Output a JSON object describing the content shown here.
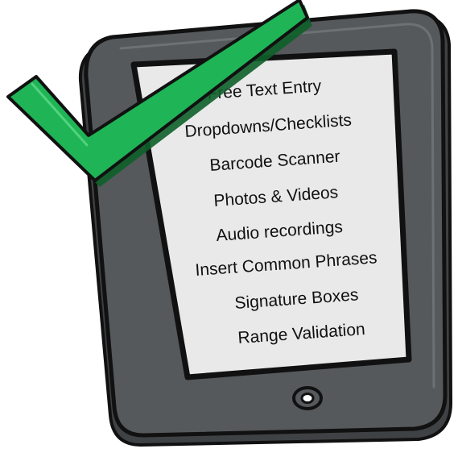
{
  "tablet": {
    "features": [
      "Free Text Entry",
      "Dropdowns/Checklists",
      "Barcode Scanner",
      "Photos & Videos",
      "Audio recordings",
      "Insert Common Phrases",
      "Signature Boxes",
      "Range Validation"
    ],
    "home_button_icon": "home-button-icon"
  },
  "checkmark": {
    "icon": "checkmark-icon"
  },
  "colors": {
    "tablet_body": "#55595c",
    "tablet_shadow": "#3f4245",
    "screen": "#e9e9e9",
    "checkmark": "#1fb456",
    "outline": "#111111"
  }
}
